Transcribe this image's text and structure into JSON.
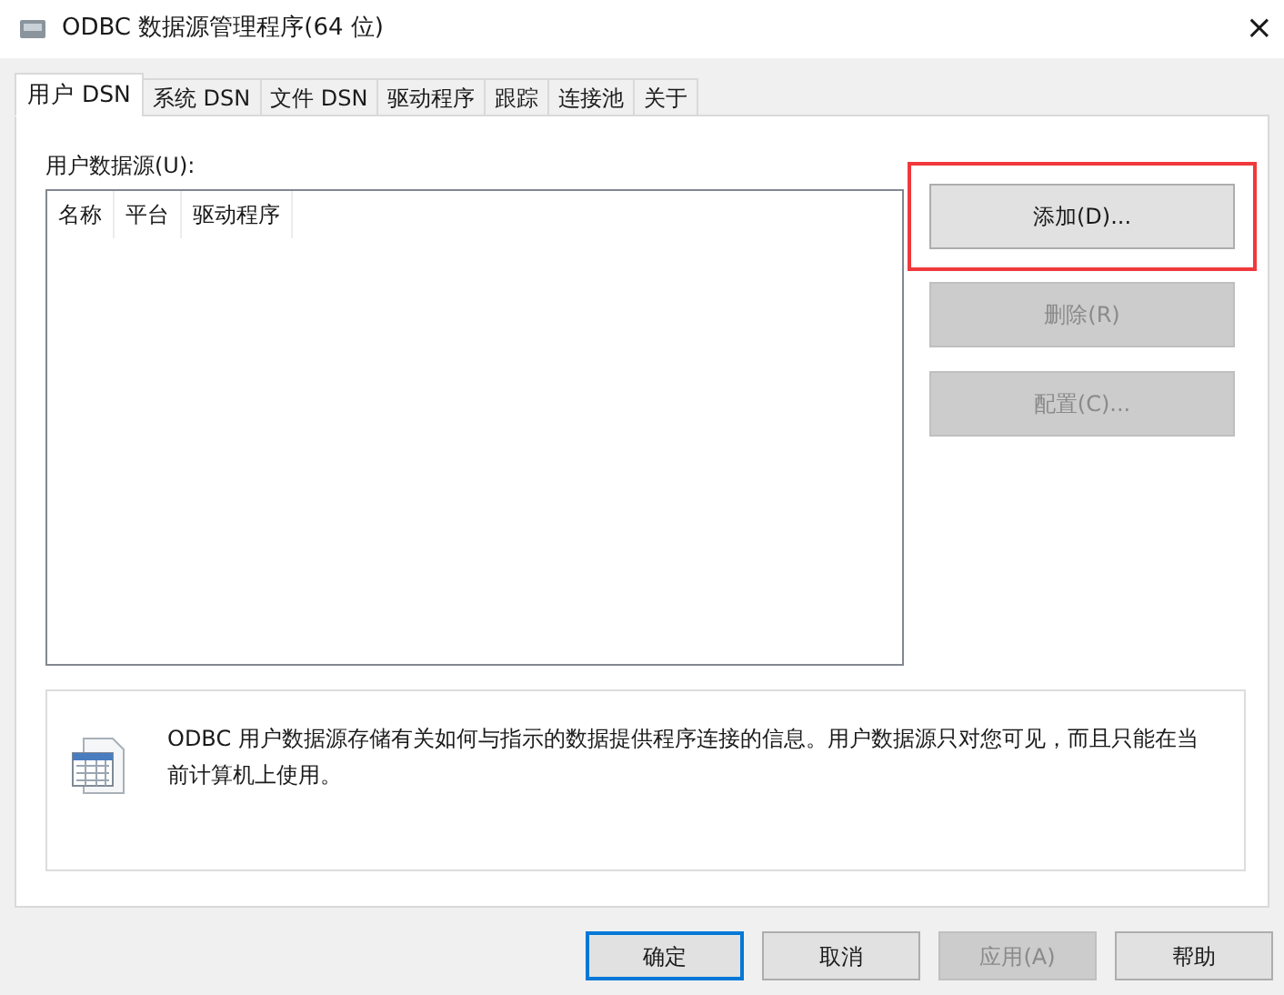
{
  "window": {
    "title": "ODBC 数据源管理程序(64 位)",
    "close": "×"
  },
  "tabs": [
    {
      "label": "用户 DSN",
      "selected": true
    },
    {
      "label": "系统 DSN",
      "selected": false
    },
    {
      "label": "文件 DSN",
      "selected": false
    },
    {
      "label": "驱动程序",
      "selected": false
    },
    {
      "label": "跟踪",
      "selected": false
    },
    {
      "label": "连接池",
      "selected": false
    },
    {
      "label": "关于",
      "selected": false
    }
  ],
  "list": {
    "label": "用户数据源(U):",
    "columns": [
      "名称",
      "平台",
      "驱动程序"
    ]
  },
  "side_buttons": [
    {
      "label": "添加(D)...",
      "disabled": false,
      "highlighted": true
    },
    {
      "label": "删除(R)",
      "disabled": true,
      "highlighted": false
    },
    {
      "label": "配置(C)...",
      "disabled": true,
      "highlighted": false
    }
  ],
  "info": {
    "text": "ODBC 用户数据源存储有关如何与指示的数据提供程序连接的信息。用户数据源只对您可见，而且只能在当前计算机上使用。"
  },
  "footer_buttons": [
    {
      "label": "确定",
      "disabled": false,
      "default": true
    },
    {
      "label": "取消",
      "disabled": false,
      "default": false
    },
    {
      "label": "应用(A)",
      "disabled": true,
      "default": false
    },
    {
      "label": "帮助",
      "disabled": false,
      "default": false
    }
  ]
}
